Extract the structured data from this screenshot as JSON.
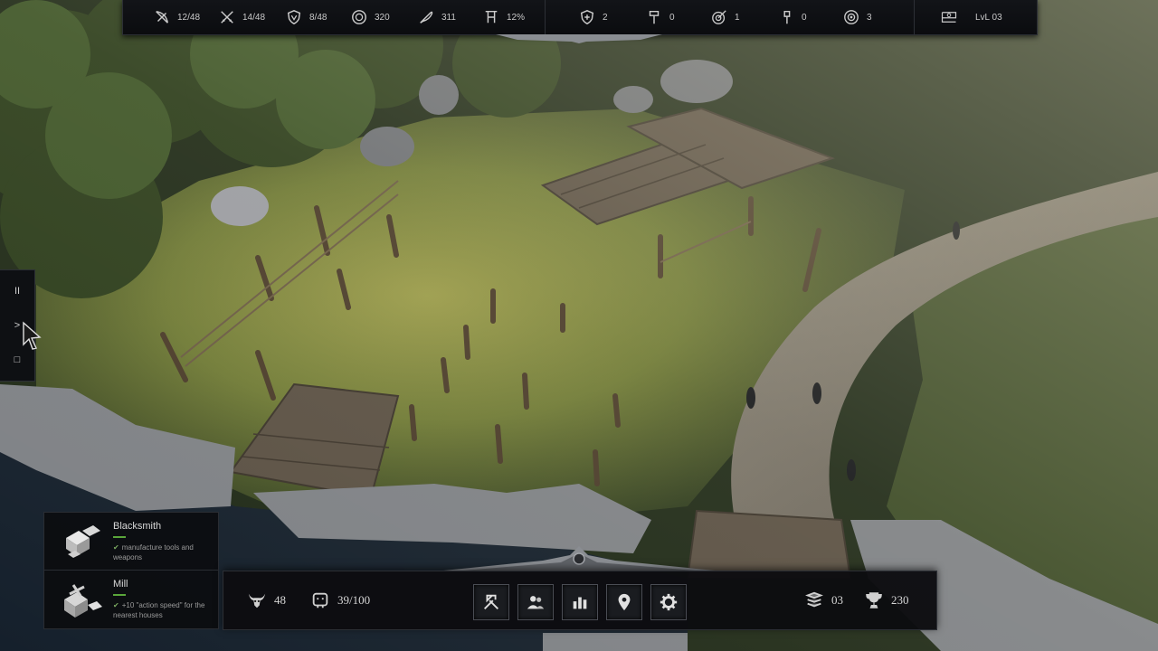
{
  "top_bar": {
    "stats": [
      {
        "icon": "hunting-bow-icon",
        "value": "12/48"
      },
      {
        "icon": "crossed-swords-icon",
        "value": "14/48"
      },
      {
        "icon": "shield-icon",
        "value": "8/48"
      },
      {
        "icon": "coin-icon",
        "value": "320"
      },
      {
        "icon": "feather-icon",
        "value": "311"
      },
      {
        "icon": "banner-icon",
        "value": "12%"
      }
    ],
    "units": [
      {
        "icon": "medic-shield-icon",
        "value": "2"
      },
      {
        "icon": "hammer-icon",
        "value": "0"
      },
      {
        "icon": "target-icon",
        "value": "1"
      },
      {
        "icon": "axe-icon",
        "value": "0"
      },
      {
        "icon": "shield-ring-icon",
        "value": "3"
      }
    ],
    "level": {
      "icon": "flag-icon",
      "label": "LvL 03"
    }
  },
  "side_controls": {
    "pause": "II",
    "play": ">",
    "stop": "□"
  },
  "buildings": [
    {
      "name": "Blacksmith",
      "description": "manufacture tools and weapons",
      "icon": "blacksmith-thumb-icon"
    },
    {
      "name": "Mill",
      "description": "+10 \"action speed\" for the nearest houses",
      "icon": "mill-thumb-icon"
    }
  ],
  "bottom_bar": {
    "resources": [
      {
        "icon": "bull-skull-icon",
        "value": "48"
      },
      {
        "icon": "population-icon",
        "value": "39/100"
      }
    ],
    "buttons": [
      {
        "icon": "build-tools-icon",
        "name": "build"
      },
      {
        "icon": "people-icon",
        "name": "villagers"
      },
      {
        "icon": "stats-icon",
        "name": "statistics"
      },
      {
        "icon": "map-pin-icon",
        "name": "map"
      },
      {
        "icon": "gear-icon",
        "name": "settings"
      }
    ],
    "right_stats": [
      {
        "icon": "layers-icon",
        "value": "03"
      },
      {
        "icon": "trophy-icon",
        "value": "230"
      }
    ]
  },
  "colors": {
    "accent_green": "#5aa63a",
    "panel": "#0c0d10"
  }
}
